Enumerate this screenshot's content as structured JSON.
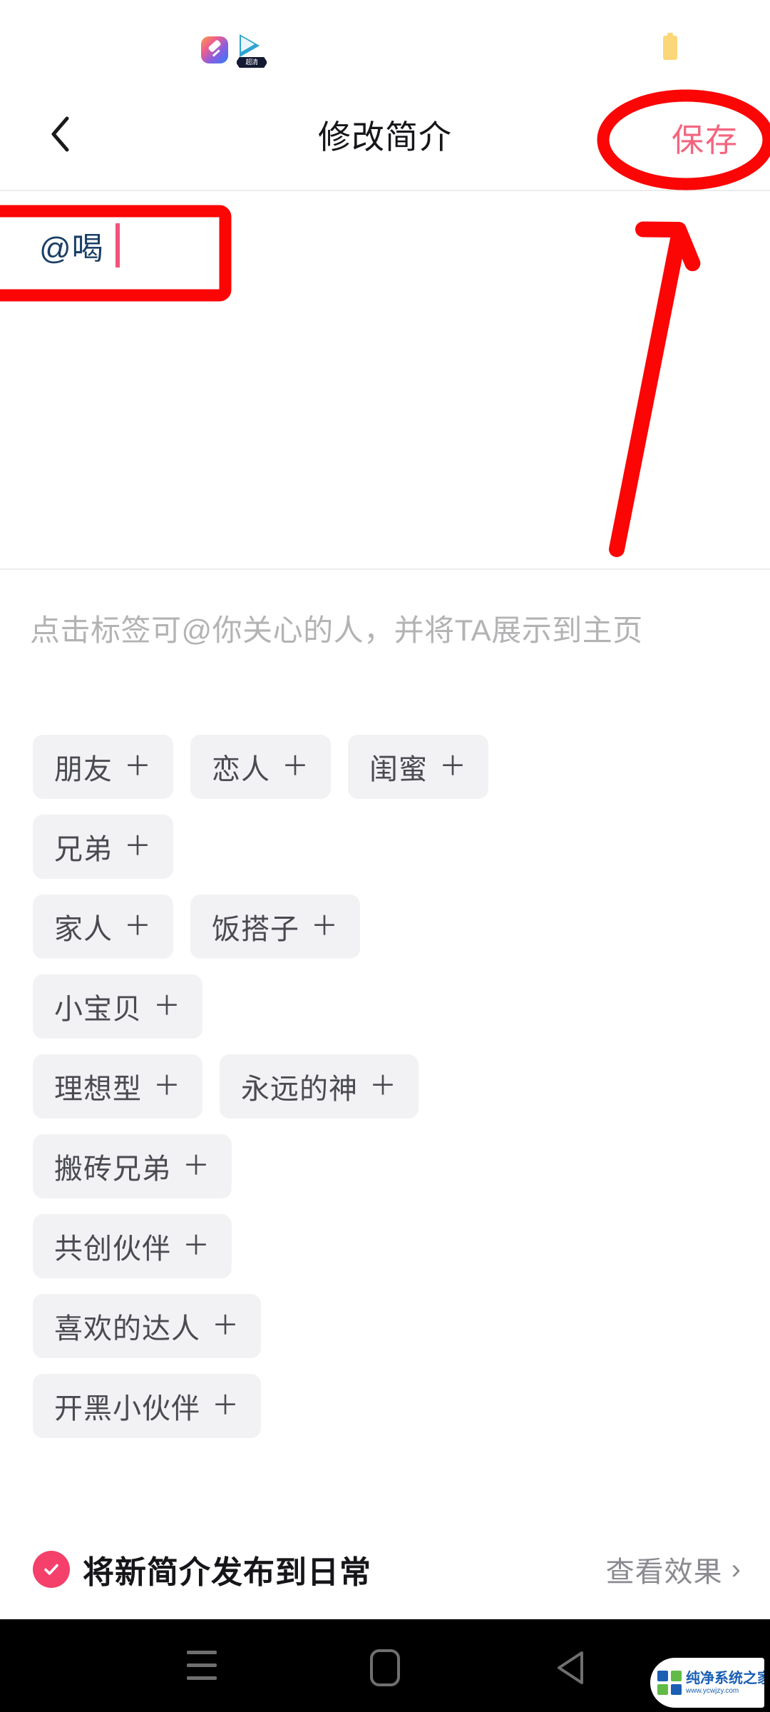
{
  "status_bar": {
    "icons": [
      "app-icon-gradient",
      "video-play-icon"
    ],
    "video_badge_text": "超清",
    "battery_color": "#fbd779"
  },
  "header": {
    "back_icon": "chevron-left-icon",
    "title": "修改简介",
    "save_label": "保存",
    "save_color": "#f4657f"
  },
  "editor": {
    "bio_text": "@喝",
    "text_color": "#1b3f66",
    "caret_color": "#f4527a"
  },
  "hint": {
    "text": "点击标签可@你关心的人，并将TA展示到主页"
  },
  "tags": {
    "plus_glyph": "＋",
    "items": [
      {
        "label": "朋友"
      },
      {
        "label": "恋人"
      },
      {
        "label": "闺蜜"
      },
      {
        "label": "兄弟"
      },
      {
        "label": "家人"
      },
      {
        "label": "饭搭子"
      },
      {
        "label": "小宝贝"
      },
      {
        "label": "理想型"
      },
      {
        "label": "永远的神"
      },
      {
        "label": "搬砖兄弟"
      },
      {
        "label": "共创伙伴"
      },
      {
        "label": "喜欢的达人"
      },
      {
        "label": "开黑小伙伴"
      }
    ]
  },
  "bottom_bar": {
    "checkbox_checked": true,
    "checkbox_color": "#f4406a",
    "publish_label": "将新简介发布到日常",
    "preview_label": "查看效果",
    "preview_chevron": "›"
  },
  "nav_bar": {
    "recents_icon": "menu-icon",
    "home_icon": "home-square-icon",
    "back_icon": "triangle-back-icon",
    "background": "#000000"
  },
  "watermark": {
    "title": "纯净系统之家",
    "url": "www.ycwjzy.com"
  },
  "annotations": {
    "color": "#fb0505",
    "save_ellipse": "ellipse around save button",
    "input_rect": "rectangle around bio input",
    "arrow": "arrow pointing to save button"
  }
}
